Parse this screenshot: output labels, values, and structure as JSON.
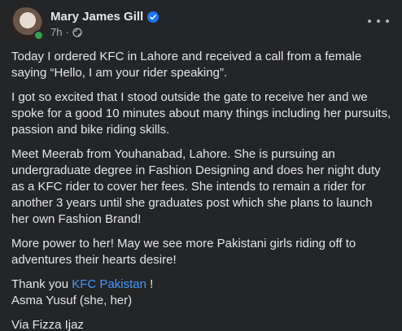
{
  "post": {
    "author": "Mary James Gill",
    "time": "7h",
    "privacy_icon": "globe-icon",
    "menu_icon": "more-options-icon",
    "p1": "Today I ordered KFC in Lahore and received a call from a female saying “Hello, I am your rider speaking”.",
    "p2": "I got so excited that I stood outside the gate to receive her and we spoke for a good 10 minutes about many things including her pursuits, passion and bike riding skills.",
    "p3": "Meet Meerab from Youhanabad, Lahore. She is pursuing an undergraduate degree in Fashion Designing and does her night duty as a KFC rider to cover her fees. She intends to remain a rider for another 3 years until she graduates post which she plans to launch her own Fashion Brand!",
    "p4": "More power to her! May we see more Pakistani girls riding off to adventures their hearts desire!",
    "thanks_prefix": "Thank you ",
    "thanks_link": "KFC Pakistan",
    "thanks_suffix": " !",
    "credit_line": "Asma Yusuf (she, her)",
    "via_line": "Via Fizza Ijaz"
  },
  "colors": {
    "background": "#242526",
    "text": "#e4e6eb",
    "secondary_text": "#b0b3b8",
    "link": "#4599ff",
    "verified": "#1877f2",
    "online": "#31a24c"
  }
}
